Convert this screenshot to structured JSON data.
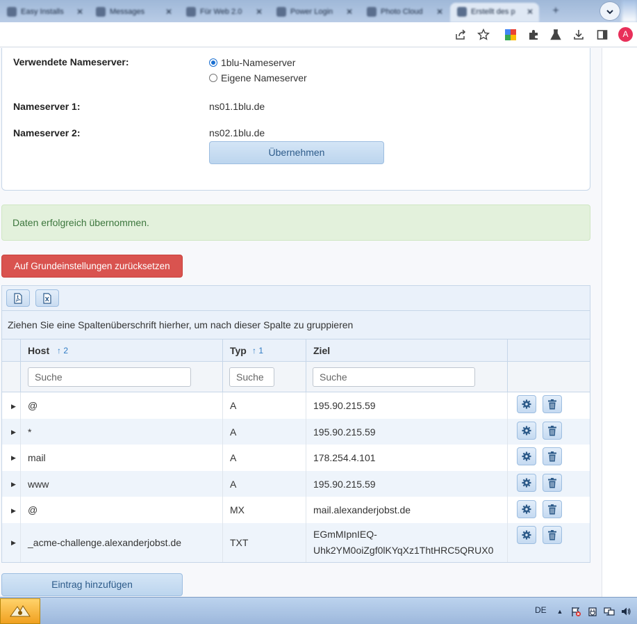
{
  "browser": {
    "tabs": [
      {
        "label": "Easy Installs",
        "active": false
      },
      {
        "label": "Messages",
        "active": false
      },
      {
        "label": "Für Web 2.0",
        "active": false
      },
      {
        "label": "Power Login",
        "active": false
      },
      {
        "label": "Photo Cloud",
        "active": false
      },
      {
        "label": "Erstellt des p",
        "active": true
      }
    ],
    "new_tab": "+",
    "avatar_letter": "A"
  },
  "nameserver": {
    "used_label": "Verwendete Nameserver:",
    "option_1blu": "1blu-Nameserver",
    "option_own": "Eigene Nameserver",
    "selected": "1blu-Nameserver",
    "ns1_label": "Nameserver 1:",
    "ns1_value": "ns01.1blu.de",
    "ns2_label": "Nameserver 2:",
    "ns2_value": "ns02.1blu.de",
    "apply_label": "Übernehmen"
  },
  "success_message": "Daten erfolgreich übernommen.",
  "reset_label": "Auf Grundeinstellungen zurücksetzen",
  "grid": {
    "group_hint": "Ziehen Sie eine Spaltenüberschrift hierher, um nach dieser Spalte zu gruppieren",
    "columns": [
      {
        "title": "Host",
        "sort": "↑ 2",
        "placeholder": "Suche"
      },
      {
        "title": "Typ",
        "sort": "↑ 1",
        "placeholder": "Suche"
      },
      {
        "title": "Ziel",
        "sort": "",
        "placeholder": "Suche"
      }
    ],
    "rows": [
      {
        "host": "@",
        "type": "A",
        "target": "195.90.215.59"
      },
      {
        "host": "*",
        "type": "A",
        "target": "195.90.215.59"
      },
      {
        "host": "mail",
        "type": "A",
        "target": "178.254.4.101"
      },
      {
        "host": "www",
        "type": "A",
        "target": "195.90.215.59"
      },
      {
        "host": "@",
        "type": "MX",
        "target": "mail.alexanderjobst.de"
      },
      {
        "host": "_acme-challenge.alexanderjobst.de",
        "type": "TXT",
        "target": "EGmMIpnIEQ-",
        "target_line2": "Uhk2YM0oiZgf0lKYqXz1ThtHRC5QRUX0"
      }
    ]
  },
  "add_label": "Eintrag hinzufügen",
  "taskbar": {
    "lang": "DE",
    "tray_arrow": "▲"
  },
  "colors": {
    "danger": "#d9534f",
    "success_bg": "#e3f1dc",
    "primary_light": "#bcd5ee",
    "avatar": "#e8305a"
  }
}
